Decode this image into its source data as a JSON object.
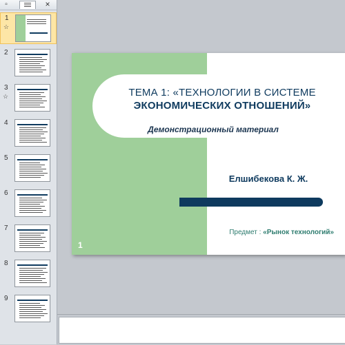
{
  "panel": {
    "tab_slides_icon": "slides-view-icon",
    "tab_outline_icon": "outline-view-icon",
    "close_label": "×"
  },
  "thumbnails": [
    {
      "number": "1",
      "has_animation": true
    },
    {
      "number": "2",
      "has_animation": false
    },
    {
      "number": "3",
      "has_animation": true
    },
    {
      "number": "4",
      "has_animation": false
    },
    {
      "number": "5",
      "has_animation": false
    },
    {
      "number": "6",
      "has_animation": false
    },
    {
      "number": "7",
      "has_animation": false
    },
    {
      "number": "8",
      "has_animation": false
    },
    {
      "number": "9",
      "has_animation": false
    }
  ],
  "animation_icon": "☆",
  "slide": {
    "title_line1": "ТЕМА  1: «ТЕХНОЛОГИИ  В СИСТЕМЕ",
    "title_line2": "ЭКОНОМИЧЕСКИХ  ОТНОШЕНИЙ»",
    "subtitle": "Демонстрационный материал",
    "author": "Елшибекова К. Ж.",
    "subject_prefix": "Предмет : ",
    "subject_name": "«Рынок технологий»",
    "number": "1"
  },
  "colors": {
    "green": "#9fcf9a",
    "navy": "#0e3a5e",
    "teal": "#2e7c6f",
    "selection": "#fde6a6"
  }
}
